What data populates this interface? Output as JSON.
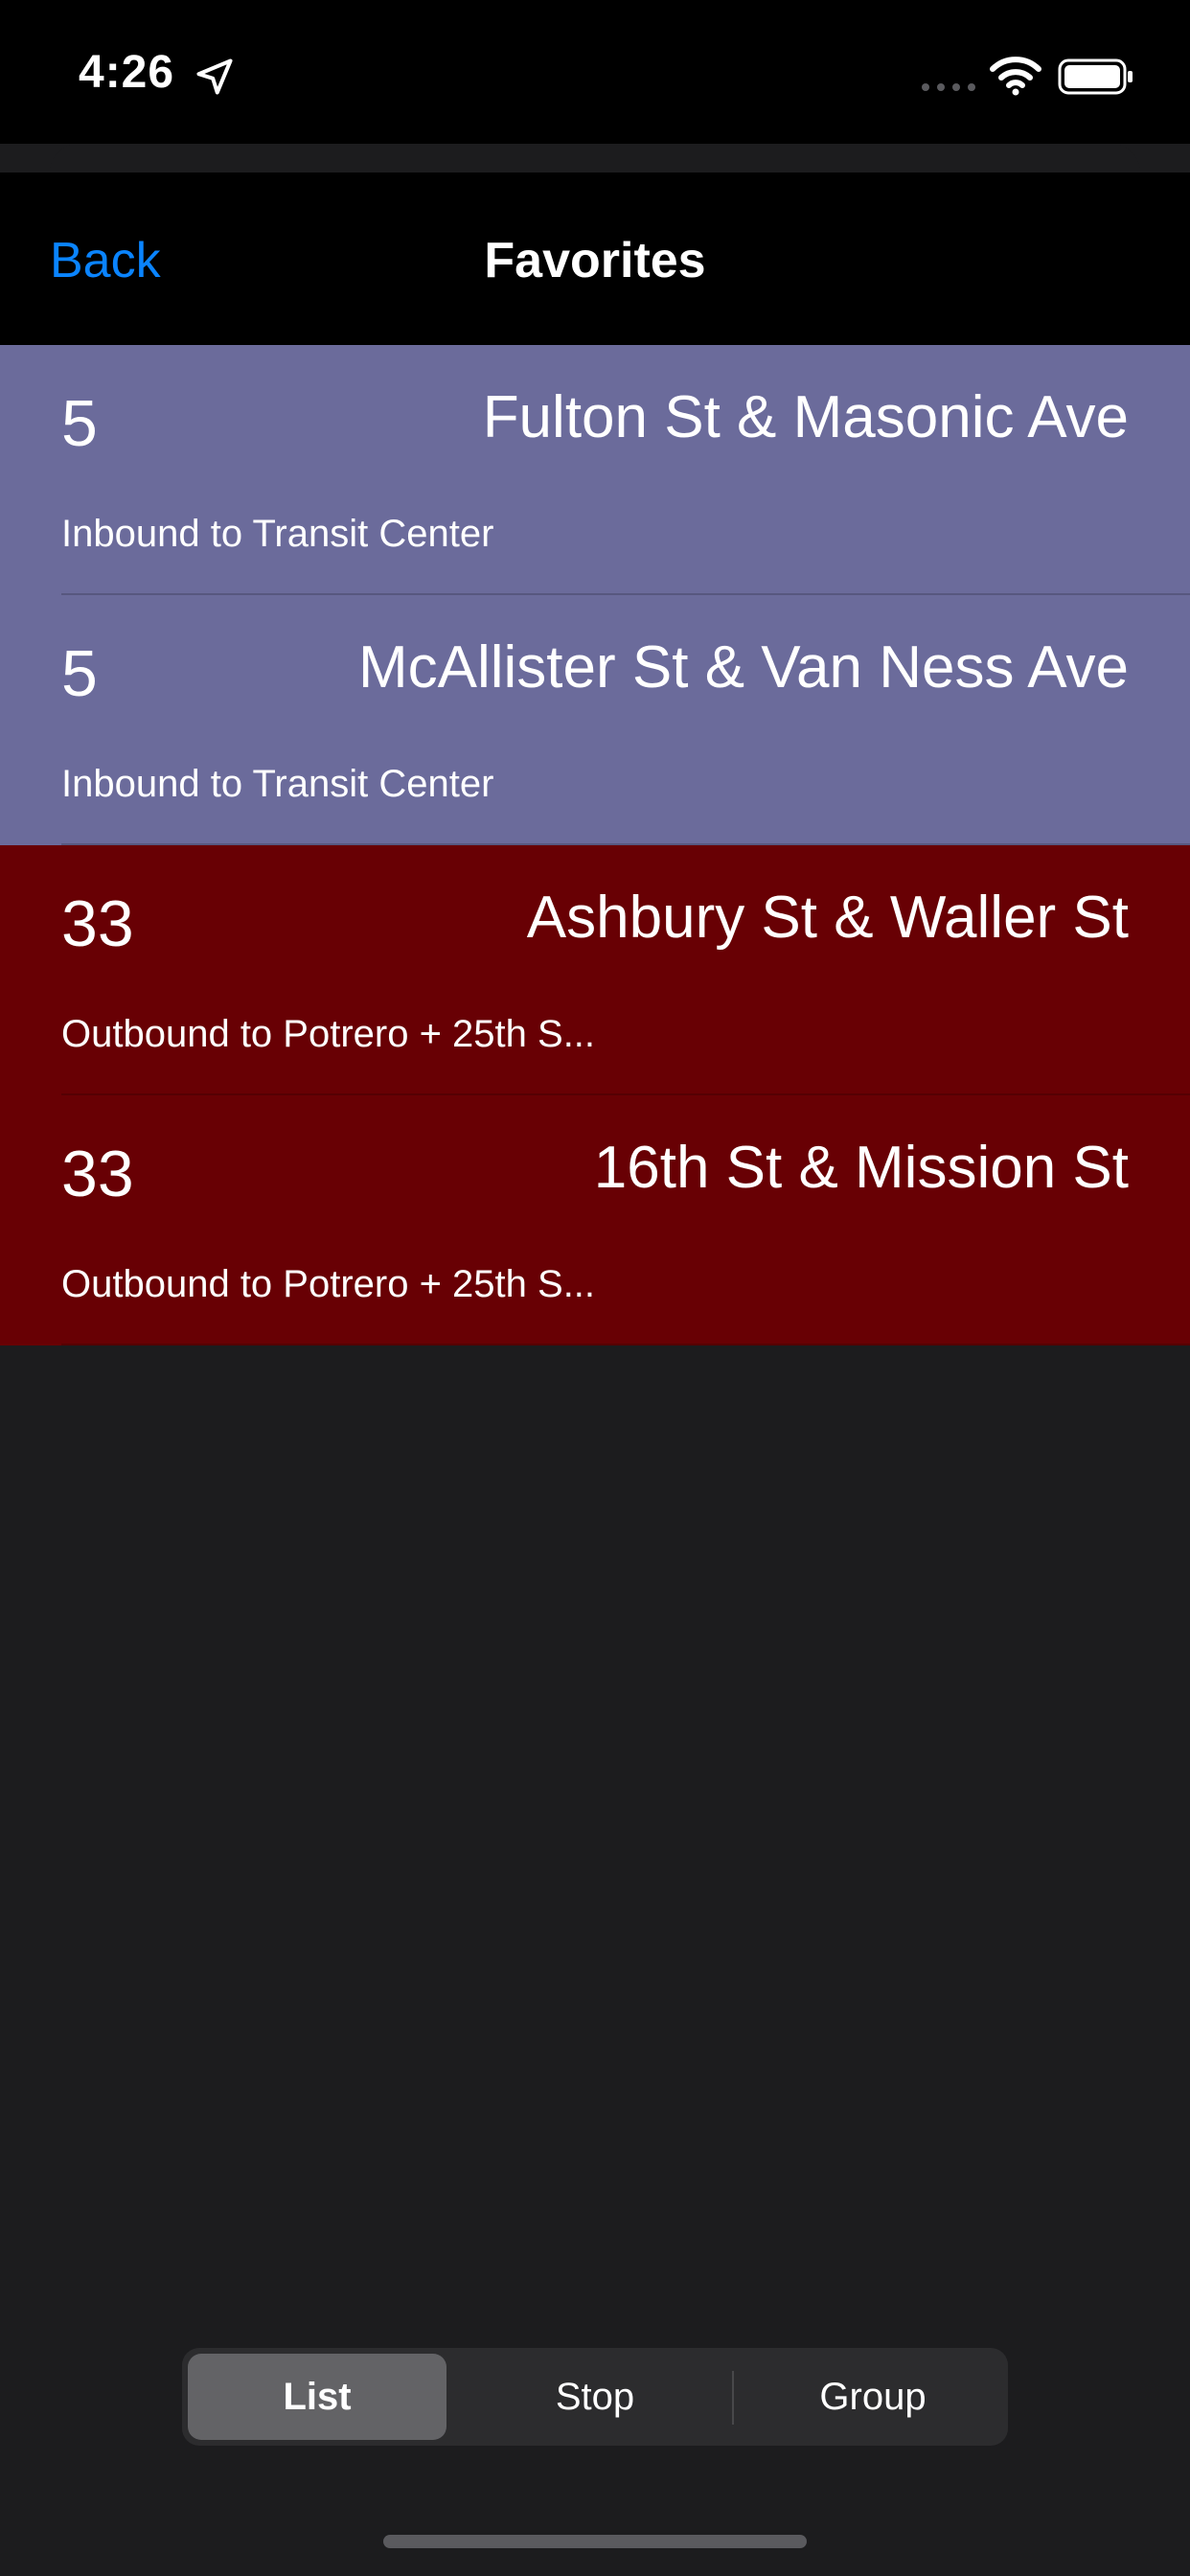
{
  "status_bar": {
    "time": "4:26",
    "icons": [
      "location-arrow-icon",
      "cellular-signal-icon",
      "wifi-icon",
      "battery-icon"
    ]
  },
  "nav": {
    "back_label": "Back",
    "title": "Favorites",
    "accent_color": "#0a84ff"
  },
  "favorites": [
    {
      "route": "5",
      "stop": "Fulton St & Masonic Ave",
      "direction": "Inbound to Transit Center",
      "color": "#6b6b9b"
    },
    {
      "route": "5",
      "stop": "McAllister St & Van Ness Ave",
      "direction": "Inbound to Transit Center",
      "color": "#6b6b9b"
    },
    {
      "route": "33",
      "stop": "Ashbury St & Waller St",
      "direction": "Outbound to Potrero + 25th S...",
      "color": "#680004"
    },
    {
      "route": "33",
      "stop": "16th St & Mission St",
      "direction": "Outbound to Potrero + 25th S...",
      "color": "#680004"
    }
  ],
  "segmented_control": {
    "options": [
      "List",
      "Stop",
      "Group"
    ],
    "selected": "List"
  }
}
